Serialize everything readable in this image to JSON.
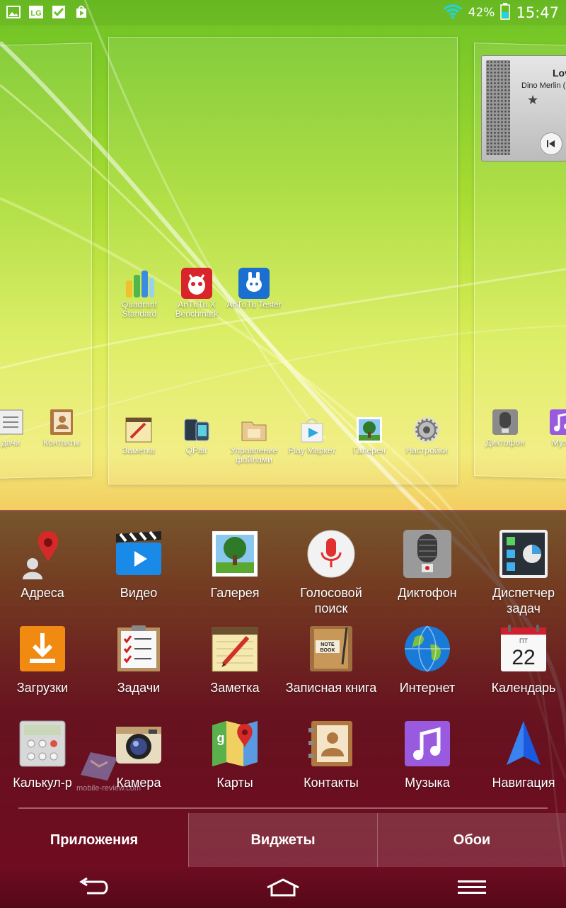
{
  "status_bar": {
    "battery_percent": "42%",
    "time": "15:47",
    "left_icons": [
      "image-icon",
      "lg-icon",
      "checkbox-icon",
      "play-store-icon"
    ],
    "lg_text": "LG"
  },
  "home": {
    "center_apps": [
      {
        "label": "Quadrant Standard",
        "icon": "quadrant-icon"
      },
      {
        "label": "AnTuTu X Benchmark",
        "icon": "antutu-icon"
      },
      {
        "label": "AnTuTu Tester",
        "icon": "antutu-tester-icon"
      }
    ],
    "center_dock": [
      {
        "label": "Заметка",
        "icon": "notebook-pencil-icon"
      },
      {
        "label": "QPair",
        "icon": "qpair-icon"
      },
      {
        "label": "Управление файлами",
        "icon": "folder-icon"
      },
      {
        "label": "Play Маркет",
        "icon": "play-store-icon"
      },
      {
        "label": "Галерея",
        "icon": "gallery-icon"
      },
      {
        "label": "Настройки",
        "icon": "gear-icon"
      }
    ],
    "left_dock": [
      {
        "label": "дачи",
        "icon": "tasks-icon"
      },
      {
        "label": "Контакты",
        "icon": "contacts-icon"
      }
    ],
    "right_dock": [
      {
        "label": "Диктофон",
        "icon": "microphone-icon"
      },
      {
        "label": "Музы",
        "icon": "music-icon"
      }
    ],
    "music_widget": {
      "title": "Lov",
      "artist": "Dino Merlin (E"
    }
  },
  "drawer": {
    "apps": [
      {
        "label": "Адреса",
        "icon": "map-pin-person-icon"
      },
      {
        "label": "Видео",
        "icon": "video-clapper-icon"
      },
      {
        "label": "Галерея",
        "icon": "gallery-icon"
      },
      {
        "label": "Голосовой поиск",
        "icon": "microphone-icon"
      },
      {
        "label": "Диктофон",
        "icon": "recorder-icon"
      },
      {
        "label": "Диспетчер задач",
        "icon": "task-manager-icon"
      },
      {
        "label": "Загрузки",
        "icon": "download-icon"
      },
      {
        "label": "Задачи",
        "icon": "checklist-icon"
      },
      {
        "label": "Заметка",
        "icon": "notebook-pencil-icon"
      },
      {
        "label": "Записная книга",
        "icon": "note-book-icon"
      },
      {
        "label": "Интернет",
        "icon": "globe-icon"
      },
      {
        "label": "Календарь",
        "icon": "calendar-icon"
      },
      {
        "label": "Калькул-р",
        "icon": "calculator-icon"
      },
      {
        "label": "Камера",
        "icon": "camera-icon"
      },
      {
        "label": "Карты",
        "icon": "maps-icon"
      },
      {
        "label": "Контакты",
        "icon": "contacts-icon"
      },
      {
        "label": "Музыка",
        "icon": "music-note-icon"
      },
      {
        "label": "Навигация",
        "icon": "navigation-arrow-icon"
      }
    ],
    "note_book_text": "NOTE BOOK",
    "calendar_day": "ПТ",
    "calendar_date": "22",
    "tabs": [
      {
        "label": "Приложения",
        "active": true
      },
      {
        "label": "Виджеты",
        "active": false
      },
      {
        "label": "Обои",
        "active": false
      }
    ]
  },
  "navbar": {
    "buttons": [
      "back-icon",
      "home-icon",
      "menu-icon"
    ]
  },
  "watermark": "mobile-review.com",
  "colors": {
    "wallpaper_top": "#7cc62a",
    "wallpaper_mid": "#e7ee5a",
    "wallpaper_bottom": "#f2b24a",
    "drawer_tint": "#5a1020",
    "navbar": "#620a1e"
  }
}
